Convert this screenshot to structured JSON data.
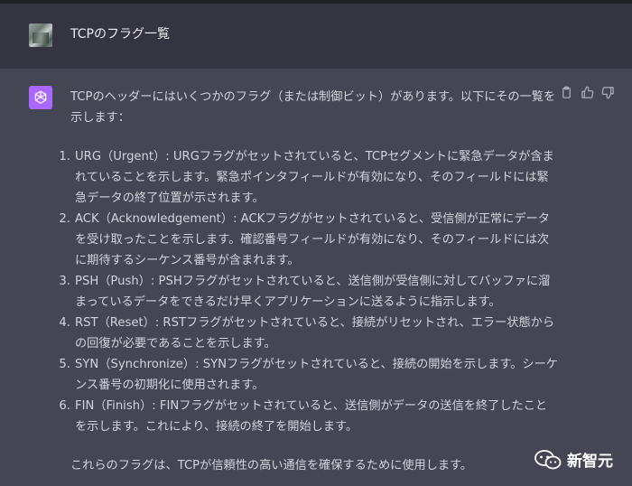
{
  "user_message": {
    "text": "TCPのフラグ一覧"
  },
  "assistant_message": {
    "intro": "TCPのヘッダーにはいくつかのフラグ（または制御ビット）があります。以下にその一覧を示します：",
    "items": [
      {
        "num": "1.",
        "text": "URG（Urgent）: URGフラグがセットされていると、TCPセグメントに緊急データが含まれていることを示します。緊急ポインタフィールドが有効になり、そのフィールドには緊急データの終了位置が示されます。"
      },
      {
        "num": "2.",
        "text": "ACK（Acknowledgement）: ACKフラグがセットされていると、受信側が正常にデータを受け取ったことを示します。確認番号フィールドが有効になり、そのフィールドには次に期待するシーケンス番号が含まれます。"
      },
      {
        "num": "3.",
        "text": "PSH（Push）: PSHフラグがセットされていると、送信側が受信側に対してバッファに溜まっているデータをできるだけ早くアプリケーションに送るように指示します。"
      },
      {
        "num": "4.",
        "text": "RST（Reset）: RSTフラグがセットされていると、接続がリセットされ、エラー状態からの回復が必要であることを示します。"
      },
      {
        "num": "5.",
        "text": "SYN（Synchronize）: SYNフラグがセットされていると、接続の開始を示します。シーケンス番号の初期化に使用されます。"
      },
      {
        "num": "6.",
        "text": "FIN（Finish）: FINフラグがセットされていると、送信側がデータの送信を終了したことを示します。これにより、接続の終了を開始します。"
      }
    ],
    "closing": "これらのフラグは、TCPが信頼性の高い通信を確保するために使用します。"
  },
  "icons": {
    "copy": "clipboard-icon",
    "thumbs_up": "thumbs-up-icon",
    "thumbs_down": "thumbs-down-icon",
    "assistant": "openai-logo-icon",
    "watermark": "wechat-icon"
  },
  "watermark": {
    "text": "新智元"
  },
  "colors": {
    "assistant_bg": "#444654",
    "user_bg": "#343541",
    "assistant_avatar": "#ab68ff",
    "text": "#d1d5db"
  }
}
